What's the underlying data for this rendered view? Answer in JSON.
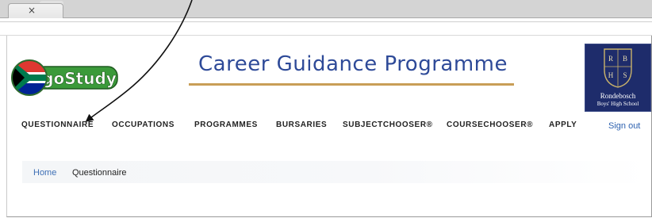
{
  "browser": {
    "tab_close_glyph": "×"
  },
  "header": {
    "logo_text": "goStudy",
    "title": "Career Guidance Programme",
    "school_name": "Rondebosch",
    "school_subtitle": "Boys' High School",
    "crest_letters": [
      "R",
      "B",
      "H",
      "S"
    ]
  },
  "nav": {
    "items": [
      {
        "label": "QUESTIONNAIRE"
      },
      {
        "label": "OCCUPATIONS"
      },
      {
        "label": "PROGRAMMES"
      },
      {
        "label": "BURSARIES"
      },
      {
        "label": "SUBJECTCHOOSER®"
      },
      {
        "label": "COURSECHOOSER®"
      },
      {
        "label": "APPLY"
      }
    ],
    "sign_out": "Sign out"
  },
  "breadcrumb": {
    "home": "Home",
    "current": "Questionnaire"
  },
  "colors": {
    "title": "#2e4a98",
    "title_rule": "#c89e56",
    "link": "#2e62b0",
    "crest_bg": "#1e2c6b",
    "logo_green": "#3b9a3a"
  }
}
